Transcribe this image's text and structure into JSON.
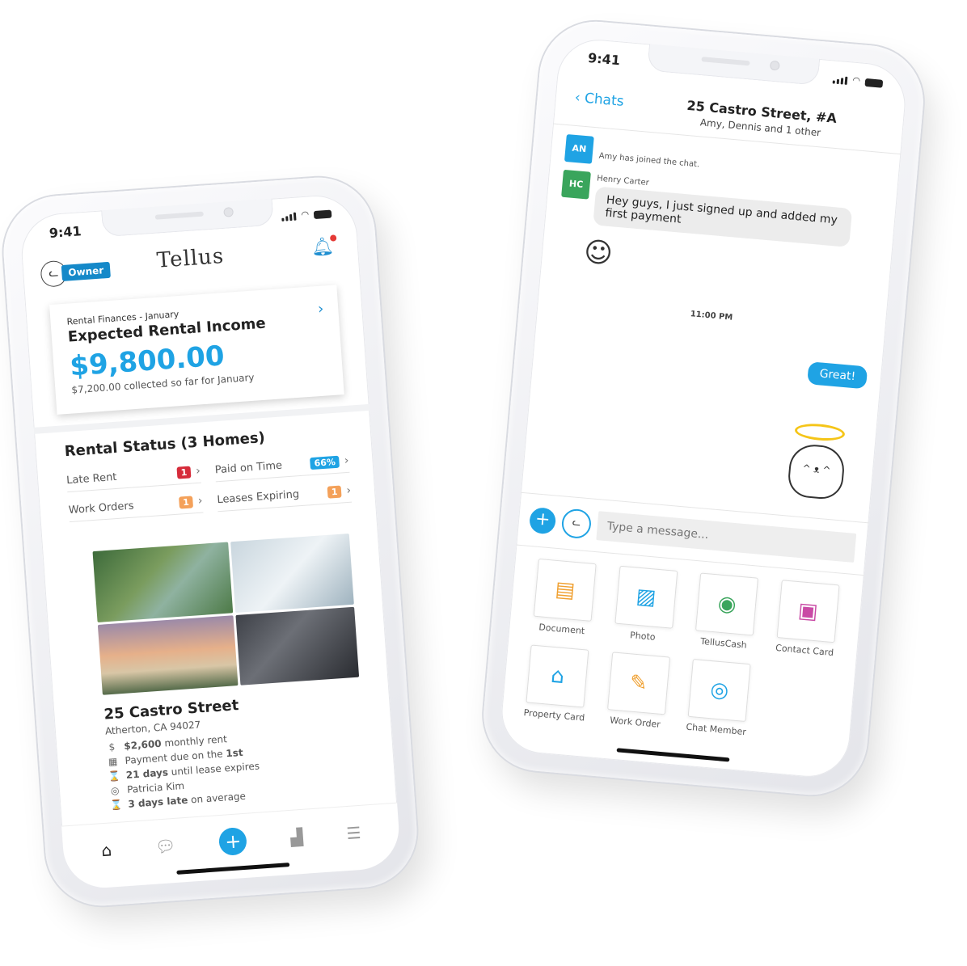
{
  "phone1": {
    "time": "9:41",
    "role_badge": "Owner",
    "brand": "Tellus",
    "finance": {
      "small_label": "Rental Finances - January",
      "title": "Expected Rental Income",
      "amount": "$9,800.00",
      "collected": "$7,200.00 collected so far for January"
    },
    "rental_status": {
      "title": "Rental Status (3 Homes)",
      "items": [
        {
          "label": "Late Rent",
          "value": "1",
          "color": "#d62b3a"
        },
        {
          "label": "Paid on Time",
          "value": "66%",
          "color": "#1fa3e4"
        },
        {
          "label": "Work Orders",
          "value": "1",
          "color": "#f4a15a"
        },
        {
          "label": "Leases Expiring",
          "value": "1",
          "color": "#f4a15a"
        }
      ]
    },
    "property": {
      "name": "25 Castro Street",
      "address": "Atherton, CA 94027",
      "rent_amount": "$2,600",
      "rent_suffix": "monthly rent",
      "payment_prefix": "Payment due on the",
      "payment_day": "1st",
      "lease_days": "21 days",
      "lease_suffix": "until lease expires",
      "tenant": "Patricia Kim",
      "late_days": "3 days late",
      "late_suffix": "on average"
    }
  },
  "phone2": {
    "time": "9:41",
    "back_label": "Chats",
    "title": "25 Castro Street, #A",
    "subtitle": "Amy, Dennis and 1 other",
    "messages": {
      "an_initials": "AN",
      "system_text": "Amy has joined the chat.",
      "hc_initials": "HC",
      "hc_sender": "Henry Carter",
      "hc_text": "Hey guys, I just signed up and added my first payment",
      "timestamp": "11:00 PM",
      "my_text": "Great!"
    },
    "input_placeholder": "Type a message...",
    "attachments": [
      {
        "label": "Document",
        "icon": "document-icon",
        "color": "#f0a030"
      },
      {
        "label": "Photo",
        "icon": "photo-icon",
        "color": "#1fa3e4"
      },
      {
        "label": "TellusCash",
        "icon": "telluscash-icon",
        "color": "#3aa55c"
      },
      {
        "label": "Contact Card",
        "icon": "contact-card-icon",
        "color": "#c94aa5"
      },
      {
        "label": "Property Card",
        "icon": "house-icon",
        "color": "#1fa3e4"
      },
      {
        "label": "Work Order",
        "icon": "wrench-icon",
        "color": "#f0a030"
      },
      {
        "label": "Chat Member",
        "icon": "person-icon",
        "color": "#1fa3e4"
      }
    ]
  }
}
